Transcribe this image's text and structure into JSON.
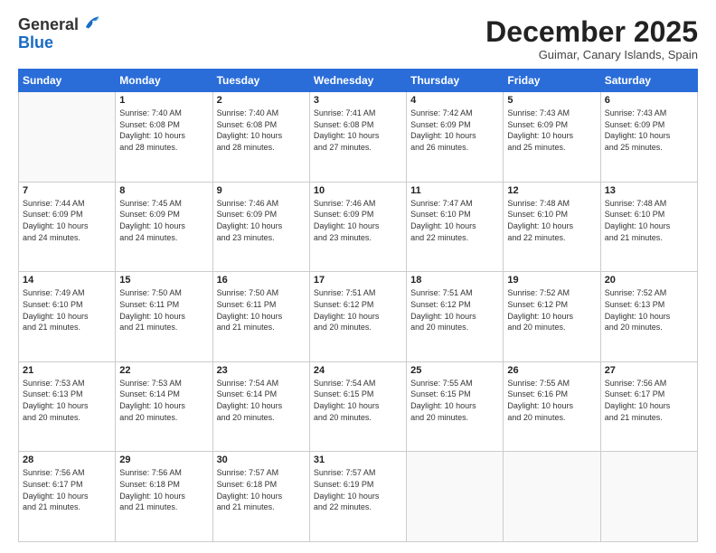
{
  "logo": {
    "general": "General",
    "blue": "Blue"
  },
  "header": {
    "month": "December 2025",
    "location": "Guimar, Canary Islands, Spain"
  },
  "days_of_week": [
    "Sunday",
    "Monday",
    "Tuesday",
    "Wednesday",
    "Thursday",
    "Friday",
    "Saturday"
  ],
  "weeks": [
    [
      {
        "day": "",
        "info": ""
      },
      {
        "day": "1",
        "info": "Sunrise: 7:40 AM\nSunset: 6:08 PM\nDaylight: 10 hours\nand 28 minutes."
      },
      {
        "day": "2",
        "info": "Sunrise: 7:40 AM\nSunset: 6:08 PM\nDaylight: 10 hours\nand 28 minutes."
      },
      {
        "day": "3",
        "info": "Sunrise: 7:41 AM\nSunset: 6:08 PM\nDaylight: 10 hours\nand 27 minutes."
      },
      {
        "day": "4",
        "info": "Sunrise: 7:42 AM\nSunset: 6:09 PM\nDaylight: 10 hours\nand 26 minutes."
      },
      {
        "day": "5",
        "info": "Sunrise: 7:43 AM\nSunset: 6:09 PM\nDaylight: 10 hours\nand 25 minutes."
      },
      {
        "day": "6",
        "info": "Sunrise: 7:43 AM\nSunset: 6:09 PM\nDaylight: 10 hours\nand 25 minutes."
      }
    ],
    [
      {
        "day": "7",
        "info": "Sunrise: 7:44 AM\nSunset: 6:09 PM\nDaylight: 10 hours\nand 24 minutes."
      },
      {
        "day": "8",
        "info": "Sunrise: 7:45 AM\nSunset: 6:09 PM\nDaylight: 10 hours\nand 24 minutes."
      },
      {
        "day": "9",
        "info": "Sunrise: 7:46 AM\nSunset: 6:09 PM\nDaylight: 10 hours\nand 23 minutes."
      },
      {
        "day": "10",
        "info": "Sunrise: 7:46 AM\nSunset: 6:09 PM\nDaylight: 10 hours\nand 23 minutes."
      },
      {
        "day": "11",
        "info": "Sunrise: 7:47 AM\nSunset: 6:10 PM\nDaylight: 10 hours\nand 22 minutes."
      },
      {
        "day": "12",
        "info": "Sunrise: 7:48 AM\nSunset: 6:10 PM\nDaylight: 10 hours\nand 22 minutes."
      },
      {
        "day": "13",
        "info": "Sunrise: 7:48 AM\nSunset: 6:10 PM\nDaylight: 10 hours\nand 21 minutes."
      }
    ],
    [
      {
        "day": "14",
        "info": "Sunrise: 7:49 AM\nSunset: 6:10 PM\nDaylight: 10 hours\nand 21 minutes."
      },
      {
        "day": "15",
        "info": "Sunrise: 7:50 AM\nSunset: 6:11 PM\nDaylight: 10 hours\nand 21 minutes."
      },
      {
        "day": "16",
        "info": "Sunrise: 7:50 AM\nSunset: 6:11 PM\nDaylight: 10 hours\nand 21 minutes."
      },
      {
        "day": "17",
        "info": "Sunrise: 7:51 AM\nSunset: 6:12 PM\nDaylight: 10 hours\nand 20 minutes."
      },
      {
        "day": "18",
        "info": "Sunrise: 7:51 AM\nSunset: 6:12 PM\nDaylight: 10 hours\nand 20 minutes."
      },
      {
        "day": "19",
        "info": "Sunrise: 7:52 AM\nSunset: 6:12 PM\nDaylight: 10 hours\nand 20 minutes."
      },
      {
        "day": "20",
        "info": "Sunrise: 7:52 AM\nSunset: 6:13 PM\nDaylight: 10 hours\nand 20 minutes."
      }
    ],
    [
      {
        "day": "21",
        "info": "Sunrise: 7:53 AM\nSunset: 6:13 PM\nDaylight: 10 hours\nand 20 minutes."
      },
      {
        "day": "22",
        "info": "Sunrise: 7:53 AM\nSunset: 6:14 PM\nDaylight: 10 hours\nand 20 minutes."
      },
      {
        "day": "23",
        "info": "Sunrise: 7:54 AM\nSunset: 6:14 PM\nDaylight: 10 hours\nand 20 minutes."
      },
      {
        "day": "24",
        "info": "Sunrise: 7:54 AM\nSunset: 6:15 PM\nDaylight: 10 hours\nand 20 minutes."
      },
      {
        "day": "25",
        "info": "Sunrise: 7:55 AM\nSunset: 6:15 PM\nDaylight: 10 hours\nand 20 minutes."
      },
      {
        "day": "26",
        "info": "Sunrise: 7:55 AM\nSunset: 6:16 PM\nDaylight: 10 hours\nand 20 minutes."
      },
      {
        "day": "27",
        "info": "Sunrise: 7:56 AM\nSunset: 6:17 PM\nDaylight: 10 hours\nand 21 minutes."
      }
    ],
    [
      {
        "day": "28",
        "info": "Sunrise: 7:56 AM\nSunset: 6:17 PM\nDaylight: 10 hours\nand 21 minutes."
      },
      {
        "day": "29",
        "info": "Sunrise: 7:56 AM\nSunset: 6:18 PM\nDaylight: 10 hours\nand 21 minutes."
      },
      {
        "day": "30",
        "info": "Sunrise: 7:57 AM\nSunset: 6:18 PM\nDaylight: 10 hours\nand 21 minutes."
      },
      {
        "day": "31",
        "info": "Sunrise: 7:57 AM\nSunset: 6:19 PM\nDaylight: 10 hours\nand 22 minutes."
      },
      {
        "day": "",
        "info": ""
      },
      {
        "day": "",
        "info": ""
      },
      {
        "day": "",
        "info": ""
      }
    ]
  ]
}
